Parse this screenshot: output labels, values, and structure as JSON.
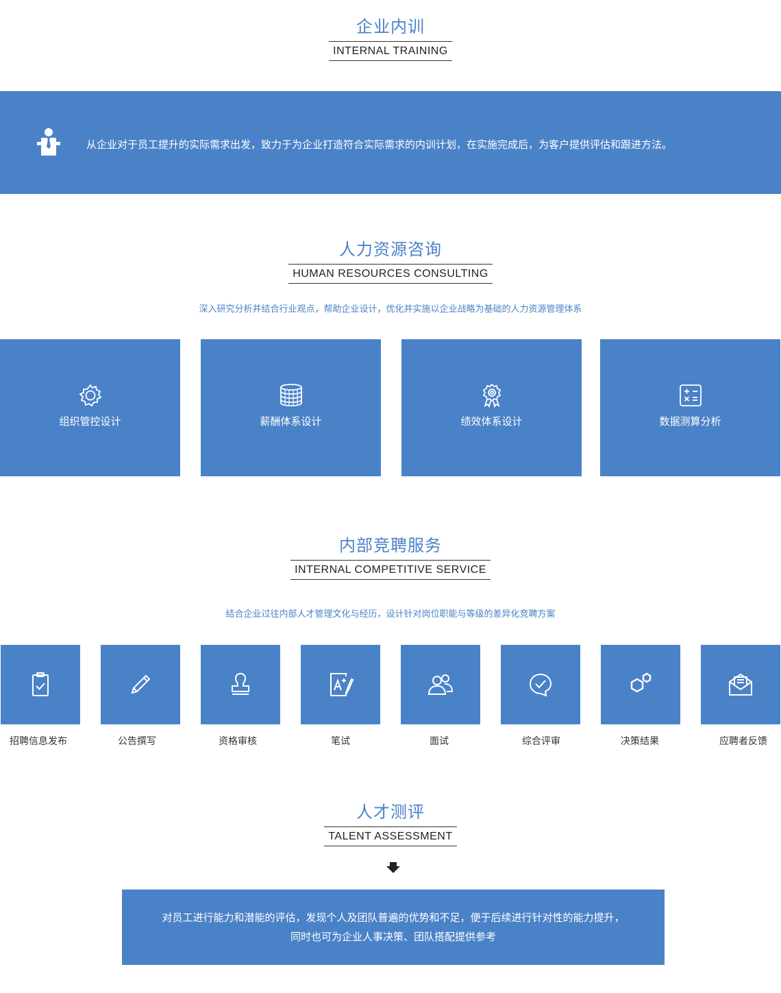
{
  "internal_training": {
    "title_cn": "企业内训",
    "title_en": "INTERNAL TRAINING",
    "description": "从企业对于员工提升的实际需求出发，致力于为企业打造符合实际需求的内训计划，在实施完成后，为客户提供评估和跟进方法。",
    "icon": "person-tie-icon"
  },
  "hr_consulting": {
    "title_cn": "人力资源咨询",
    "title_en": "HUMAN RESOURCES CONSULTING",
    "description": "深入研究分析并结合行业观点，帮助企业设计，优化并实施以企业战略为基础的人力资源管理体系",
    "cards": [
      {
        "label": "组织管控设计",
        "icon": "gear-icon"
      },
      {
        "label": "薪酬体系设计",
        "icon": "coin-stack-icon"
      },
      {
        "label": "绩效体系设计",
        "icon": "award-badge-icon"
      },
      {
        "label": "数据测算分析",
        "icon": "calculator-icon"
      }
    ]
  },
  "competitive_service": {
    "title_cn": "内部竞聘服务",
    "title_en": "INTERNAL COMPETITIVE SERVICE",
    "description": "结合企业过往内部人才管理文化与经历，设计针对岗位职能与等级的差异化竞聘方案",
    "steps": [
      {
        "label": "招聘信息发布",
        "icon": "clipboard-check-icon"
      },
      {
        "label": "公告撰写",
        "icon": "pencil-icon"
      },
      {
        "label": "资格审核",
        "icon": "stamp-icon"
      },
      {
        "label": "笔试",
        "icon": "exam-paper-icon"
      },
      {
        "label": "面试",
        "icon": "people-icon"
      },
      {
        "label": "综合评审",
        "icon": "check-bubble-icon"
      },
      {
        "label": "决策结果",
        "icon": "hexagons-icon"
      },
      {
        "label": "应聘者反馈",
        "icon": "envelope-icon"
      }
    ]
  },
  "talent_assessment": {
    "title_cn": "人才测评",
    "title_en": "TALENT ASSESSMENT",
    "line1": "对员工进行能力和潜能的评估，发现个人及团队普遍的优势和不足，便于后续进行针对性的能力提升，",
    "line2": "同时也可为企业人事决策、团队搭配提供参考"
  },
  "colors": {
    "primary": "#4a82c8",
    "white": "#ffffff",
    "text": "#333333"
  }
}
